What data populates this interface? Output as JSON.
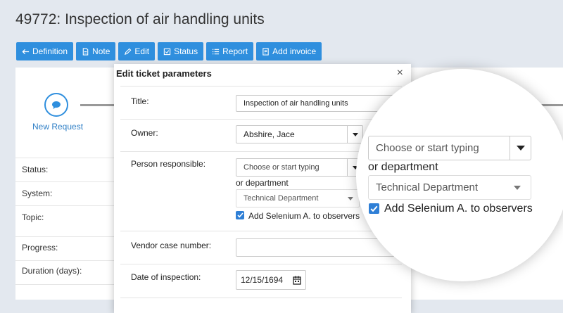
{
  "page": {
    "title": "49772: Inspection of air handling units"
  },
  "toolbar": {
    "buttons": [
      {
        "label": "Definition",
        "icon": "arrow-left-icon"
      },
      {
        "label": "Note",
        "icon": "document-icon"
      },
      {
        "label": "Edit",
        "icon": "pencil-icon"
      },
      {
        "label": "Status",
        "icon": "check-square-icon"
      },
      {
        "label": "Report",
        "icon": "list-icon"
      },
      {
        "label": "Add invoice",
        "icon": "invoice-icon"
      }
    ]
  },
  "workflow": {
    "first_step_label": "New Request"
  },
  "sidebar": {
    "rows": [
      {
        "label": "Status:"
      },
      {
        "label": "System:"
      },
      {
        "label": "Topic:"
      },
      {
        "label": "Progress:"
      },
      {
        "label": "Duration (days):"
      }
    ]
  },
  "modal": {
    "title": "Edit ticket parameters",
    "close_glyph": "×",
    "fields": {
      "title": {
        "label": "Title:",
        "value": "Inspection of air handling units"
      },
      "owner": {
        "label": "Owner:",
        "value": "Abshire, Jace"
      },
      "person_responsible": {
        "label": "Person responsible:",
        "placeholder": "Choose or start typing",
        "or_department": "or department",
        "department_value": "Technical Department",
        "observer_checkbox_label": "Add Selenium A. to observers",
        "observer_checked": true
      },
      "vendor_case_number": {
        "label": "Vendor case number:",
        "value": ""
      },
      "date_of_inspection": {
        "label": "Date of inspection:",
        "value": "12/15/1694"
      }
    }
  },
  "magnifier": {
    "placeholder": "Choose or start typing",
    "or_department": "or department",
    "department_value": "Technical Department",
    "observer_checkbox_label": "Add Selenium A. to observers"
  },
  "colors": {
    "accent": "#2f8fde",
    "background": "#e3e8ef",
    "checkbox": "#2f7fd6"
  }
}
